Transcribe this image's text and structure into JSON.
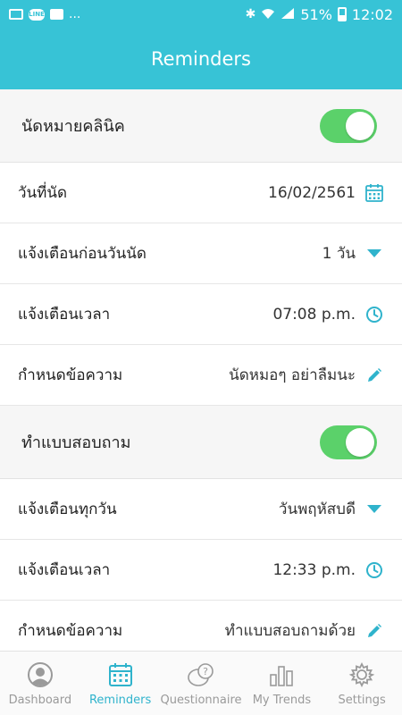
{
  "status_bar": {
    "line_label": "LINE",
    "ellipsis": "...",
    "battery": "51%",
    "time": "12:02"
  },
  "header": {
    "title": "Reminders"
  },
  "clinic_section": {
    "title": "นัดหมายคลินิค",
    "toggle_on": true,
    "rows": [
      {
        "label": "วันที่นัด",
        "value": "16/02/2561",
        "icon": "calendar-icon"
      },
      {
        "label": "แจ้งเตือนก่อนวันนัด",
        "value": "1 วัน",
        "icon": "dropdown-caret-icon"
      },
      {
        "label": "แจ้งเตือนเวลา",
        "value": "07:08 p.m.",
        "icon": "clock-icon"
      },
      {
        "label": "กำหนดข้อความ",
        "value": "นัดหมอๆ อย่าลืมนะ",
        "icon": "edit-pencil-icon"
      }
    ]
  },
  "questionnaire_section": {
    "title": "ทำแบบสอบถาม",
    "toggle_on": true,
    "rows": [
      {
        "label": "แจ้งเตือนทุกวัน",
        "value": "วันพฤหัสบดี",
        "icon": "dropdown-caret-icon"
      },
      {
        "label": "แจ้งเตือนเวลา",
        "value": "12:33 p.m.",
        "icon": "clock-icon"
      },
      {
        "label": "กำหนดข้อความ",
        "value": "ทำแบบสอบถามด้วย",
        "icon": "edit-pencil-icon"
      }
    ]
  },
  "tabs": [
    {
      "label": "Dashboard",
      "icon": "profile-icon",
      "active": false
    },
    {
      "label": "Reminders",
      "icon": "calendar-icon",
      "active": true
    },
    {
      "label": "Questionnaire",
      "icon": "question-bubble-icon",
      "active": false
    },
    {
      "label": "My Trends",
      "icon": "bar-chart-icon",
      "active": false
    },
    {
      "label": "Settings",
      "icon": "gear-icon",
      "active": false
    }
  ],
  "colors": {
    "primary": "#37c3d6",
    "accent": "#2fb3cc",
    "toggle_on": "#5bd16a",
    "tab_inactive": "#9a9a9a"
  }
}
